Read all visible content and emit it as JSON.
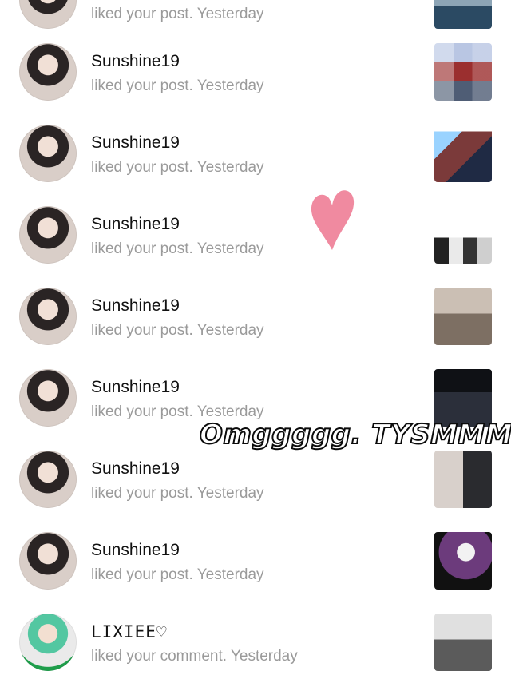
{
  "notifications": [
    {
      "user": "",
      "message": "liked your post. Yesterday",
      "avatar": "avatar-photo",
      "thumb": "post-thumbnail"
    },
    {
      "user": "Sunshine19",
      "message": "liked your post. Yesterday",
      "avatar": "avatar-photo",
      "thumb": "post-thumbnail"
    },
    {
      "user": "Sunshine19",
      "message": "liked your post. Yesterday",
      "avatar": "avatar-photo",
      "thumb": "post-thumbnail"
    },
    {
      "user": "Sunshine19",
      "message": "liked your post. Yesterday",
      "avatar": "avatar-photo",
      "thumb": "post-thumbnail"
    },
    {
      "user": "Sunshine19",
      "message": "liked your post. Yesterday",
      "avatar": "avatar-photo",
      "thumb": "post-thumbnail"
    },
    {
      "user": "Sunshine19",
      "message": "liked your post. Yesterday",
      "avatar": "avatar-photo",
      "thumb": "post-thumbnail"
    },
    {
      "user": "Sunshine19",
      "message": "liked your post. Yesterday",
      "avatar": "avatar-photo",
      "thumb": "post-thumbnail"
    },
    {
      "user": "Sunshine19",
      "message": "liked your post. Yesterday",
      "avatar": "avatar-photo",
      "thumb": "post-thumbnail"
    },
    {
      "user": "LIXIEE♡",
      "message": "liked your comment. Yesterday",
      "avatar": "avatar-photo",
      "thumb": "post-thumbnail"
    }
  ],
  "overlay_text": "Omggggg. TYSMMM!",
  "colors": {
    "username": "#111111",
    "message": "#9a9a9a",
    "heart": "#f08aa0",
    "background": "#ffffff"
  },
  "icons": {
    "heart_sticker": "heart-icon"
  }
}
